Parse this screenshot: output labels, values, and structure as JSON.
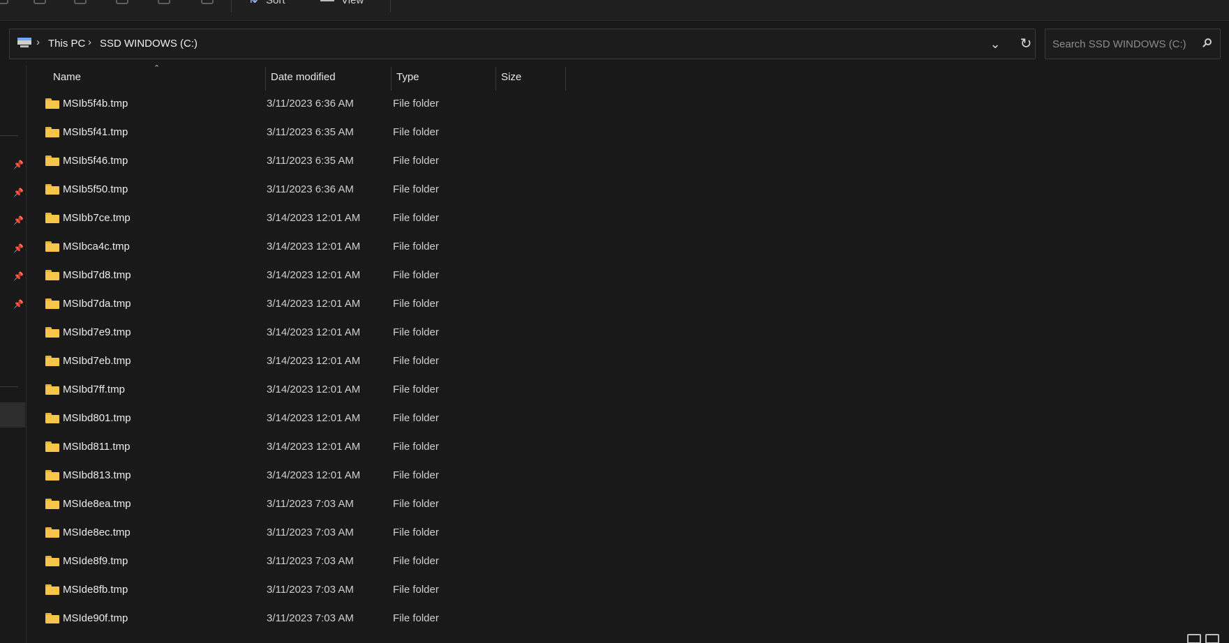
{
  "commandbar": {
    "sort_label": "Sort",
    "view_label": "View"
  },
  "address": {
    "breadcrumb": [
      "This PC",
      "SSD WINDOWS (C:)"
    ]
  },
  "search": {
    "placeholder": "Search SSD WINDOWS (C:)"
  },
  "columns": {
    "name": "Name",
    "date": "Date modified",
    "type": "Type",
    "size": "Size"
  },
  "files": [
    {
      "name": "MSIb5f4b.tmp",
      "date": "3/11/2023 6:36 AM",
      "type": "File folder"
    },
    {
      "name": "MSIb5f41.tmp",
      "date": "3/11/2023 6:35 AM",
      "type": "File folder"
    },
    {
      "name": "MSIb5f46.tmp",
      "date": "3/11/2023 6:35 AM",
      "type": "File folder"
    },
    {
      "name": "MSIb5f50.tmp",
      "date": "3/11/2023 6:36 AM",
      "type": "File folder"
    },
    {
      "name": "MSIbb7ce.tmp",
      "date": "3/14/2023 12:01 AM",
      "type": "File folder"
    },
    {
      "name": "MSIbca4c.tmp",
      "date": "3/14/2023 12:01 AM",
      "type": "File folder"
    },
    {
      "name": "MSIbd7d8.tmp",
      "date": "3/14/2023 12:01 AM",
      "type": "File folder"
    },
    {
      "name": "MSIbd7da.tmp",
      "date": "3/14/2023 12:01 AM",
      "type": "File folder"
    },
    {
      "name": "MSIbd7e9.tmp",
      "date": "3/14/2023 12:01 AM",
      "type": "File folder"
    },
    {
      "name": "MSIbd7eb.tmp",
      "date": "3/14/2023 12:01 AM",
      "type": "File folder"
    },
    {
      "name": "MSIbd7ff.tmp",
      "date": "3/14/2023 12:01 AM",
      "type": "File folder"
    },
    {
      "name": "MSIbd801.tmp",
      "date": "3/14/2023 12:01 AM",
      "type": "File folder"
    },
    {
      "name": "MSIbd811.tmp",
      "date": "3/14/2023 12:01 AM",
      "type": "File folder"
    },
    {
      "name": "MSIbd813.tmp",
      "date": "3/14/2023 12:01 AM",
      "type": "File folder"
    },
    {
      "name": "MSIde8ea.tmp",
      "date": "3/11/2023 7:03 AM",
      "type": "File folder"
    },
    {
      "name": "MSIde8ec.tmp",
      "date": "3/11/2023 7:03 AM",
      "type": "File folder"
    },
    {
      "name": "MSIde8f9.tmp",
      "date": "3/11/2023 7:03 AM",
      "type": "File folder"
    },
    {
      "name": "MSIde8fb.tmp",
      "date": "3/11/2023 7:03 AM",
      "type": "File folder"
    },
    {
      "name": "MSIde90f.tmp",
      "date": "3/11/2023 7:03 AM",
      "type": "File folder"
    }
  ],
  "icons": {
    "location": "this-pc-icon",
    "folder": "folder-icon",
    "pin": "pin-icon",
    "search": "search-icon"
  },
  "colors": {
    "background": "#191919",
    "folder": "#f5c64a",
    "text": "#ececec"
  }
}
